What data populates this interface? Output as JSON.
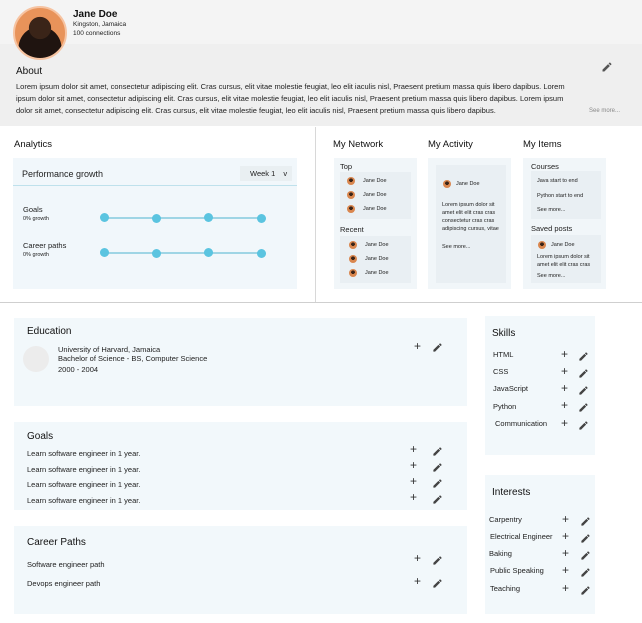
{
  "profile": {
    "name": "Jane Doe",
    "location": "Kingston, Jamaica",
    "connections": "100 connections"
  },
  "about": {
    "title": "About",
    "text": "Lorem ipsum dolor sit amet, consectetur adipiscing elit. Cras cursus, elit vitae molestie feugiat, leo elit iaculis nisl, Praesent pretium massa quis libero dapibus. Lorem ipsum dolor sit amet, consectetur adipiscing elit. Cras cursus, elit vitae molestie feugiat, leo elit iaculis nisl, Praesent pretium massa quis libero dapibus. Lorem ipsum dolor sit amet, consectetur adipiscing elit. Cras cursus, elit vitae molestie feugiat, leo elit iaculis nisl, Praesent pretium massa quis libero dapibus.",
    "see_more": "See more..."
  },
  "analytics": {
    "title": "Analytics",
    "card_title": "Performance growth",
    "week": "Week 1",
    "week_caret": "v",
    "rows": [
      {
        "label": "Goals",
        "growth": "0% growth"
      },
      {
        "label": "Career paths",
        "growth": "0% growth"
      }
    ]
  },
  "network": {
    "title": "My Network",
    "top_label": "Top",
    "top": [
      "Jane Doe",
      "Jane Doe",
      "Jane Doe"
    ],
    "recent_label": "Recent",
    "recent": [
      "Jane Doe",
      "Jane Doe",
      "Jane Doe"
    ]
  },
  "activity": {
    "title": "My Activity",
    "name": "Jane Doe",
    "text": "Lorem ipsum dolor sit amet  elit elit cras cras consectetur cras cras adipiscing cursus,  vitae",
    "see_more": "See more..."
  },
  "items": {
    "title": "My Items",
    "courses_label": "Courses",
    "courses": [
      "Java start to end",
      "Python start to end"
    ],
    "courses_see_more": "See more...",
    "saved_label": "Saved posts",
    "saved_name": "Jane Doe",
    "saved_text": "Lorem ipsum dolor sit amet  elit elit cras cras",
    "saved_see_more": "See more..."
  },
  "education": {
    "title": "Education",
    "school": "University of Harvard, Jamaica",
    "degree": "Bachelor of Science - BS, Computer Science",
    "years": "2000 - 2004"
  },
  "goals": {
    "title": "Goals",
    "items": [
      "Learn software engineer in 1 year.",
      "Learn software engineer in 1 year.",
      "Learn software engineer in 1 year.",
      "Learn software engineer in 1 year."
    ]
  },
  "career": {
    "title": "Career Paths",
    "items": [
      "Software engineer path",
      "Devops engineer path"
    ]
  },
  "skills": {
    "title": "Skills",
    "items": [
      "HTML",
      "CSS",
      "JavaScript",
      "Python",
      "Communication"
    ]
  },
  "interests": {
    "title": "Interests",
    "items": [
      "Carpentry",
      "Electrical Engineer",
      "Baking",
      "Public Speaking",
      "Teaching"
    ]
  },
  "icons": {
    "plus": "+",
    "edit": "pencil-icon",
    "add": "plus-icon"
  }
}
